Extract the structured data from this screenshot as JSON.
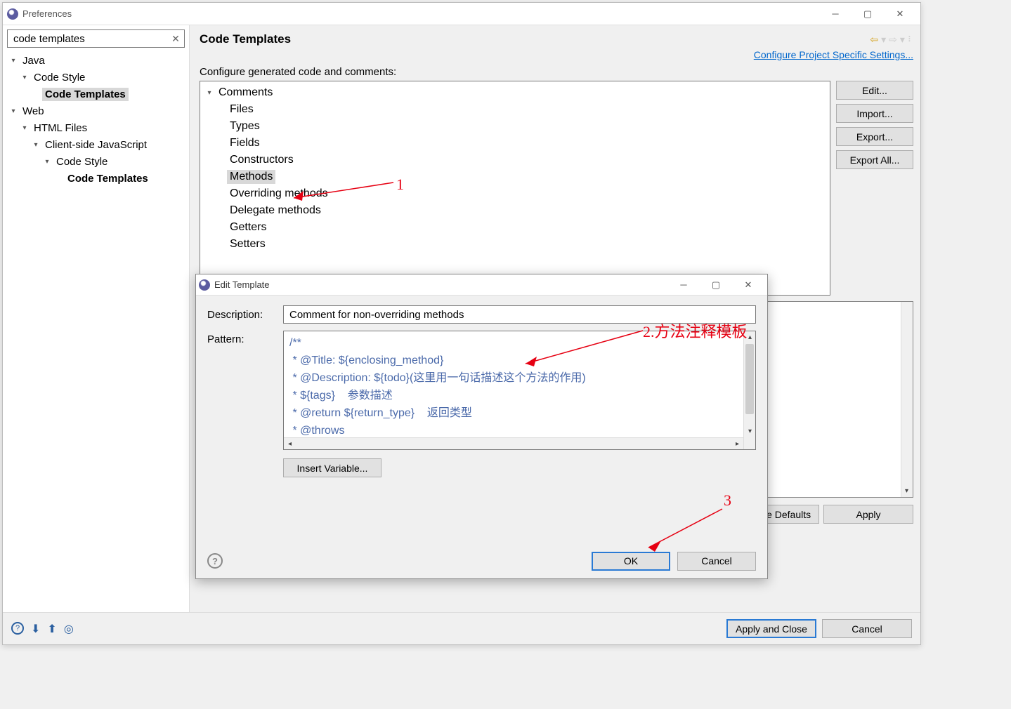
{
  "window": {
    "title": "Preferences",
    "search_value": "code templates"
  },
  "nav": {
    "java": "Java",
    "code_style": "Code Style",
    "code_templates": "Code Templates",
    "web": "Web",
    "html_files": "HTML Files",
    "client_js": "Client-side JavaScript",
    "code_style2": "Code Style",
    "code_templates2": "Code Templates"
  },
  "page": {
    "heading": "Code Templates",
    "project_link": "Configure Project Specific Settings...",
    "configure_label": "Configure generated code and comments:",
    "buttons": {
      "edit": "Edit...",
      "import": "Import...",
      "export": "Export...",
      "export_all": "Export All..."
    },
    "tree": {
      "comments": "Comments",
      "items": [
        "Files",
        "Types",
        "Fields",
        "Constructors",
        "Methods",
        "Overriding methods",
        "Delegate methods",
        "Getters",
        "Setters"
      ]
    },
    "footer": {
      "restore": "Restore Defaults",
      "apply": "Apply"
    }
  },
  "mainfoot": {
    "apply_close": "Apply and Close",
    "cancel": "Cancel"
  },
  "dialog": {
    "title": "Edit Template",
    "desc_label": "Description:",
    "desc_value": "Comment for non-overriding methods",
    "pattern_label": "Pattern:",
    "pattern_lines": [
      "/**",
      " * @Title: ${enclosing_method}",
      " * @Description: ${todo}(这里用一句话描述这个方法的作用)",
      " * ${tags}    参数描述",
      " * @return ${return_type}    返回类型",
      " * @throws"
    ],
    "insert_var": "Insert Variable...",
    "ok": "OK",
    "cancel": "Cancel"
  },
  "annotations": {
    "a1": "1",
    "a2": "2.方法注释模板",
    "a3": "3"
  }
}
